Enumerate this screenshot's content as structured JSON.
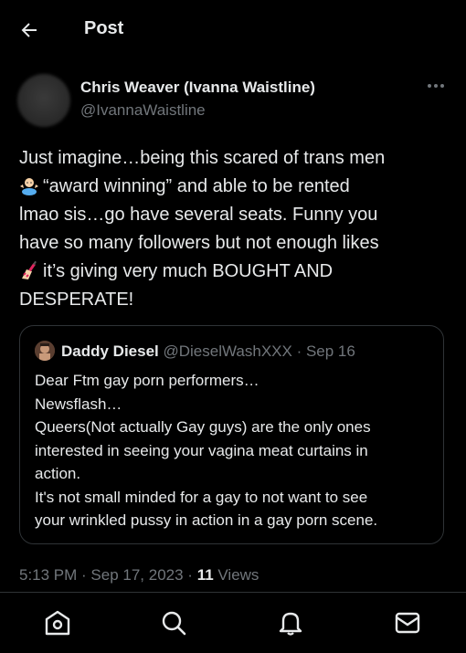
{
  "header": {
    "title": "Post"
  },
  "tweet": {
    "author_name": "Chris Weaver (Ivanna Waistline)",
    "author_handle": "@IvannaWaistline",
    "lines": [
      "Just imagine…being this scared of trans men",
      "“award winning” and able to be rented",
      "lmao sis…go have several seats. Funny you",
      "have so many followers but not enough likes",
      "it’s giving very much BOUGHT AND",
      "DESPERATE!"
    ],
    "emoji_1": "person-shrugging-emoji",
    "emoji_2": "nail-polish-emoji"
  },
  "quote": {
    "author_name": "Daddy Diesel",
    "author_handle": "@DieselWashXXX",
    "separator": " · ",
    "date": "Sep 16",
    "lines": [
      "Dear Ftm gay porn performers…",
      "Newsflash…",
      "Queers(Not actually Gay guys) are the only ones",
      "interested in seeing your vagina meat curtains in",
      "action.",
      "It's not small minded for a gay to not want to see",
      "your wrinkled pussy in action in a gay porn scene."
    ]
  },
  "meta": {
    "time": "5:13 PM",
    "sep1": " · ",
    "date": "Sep 17, 2023",
    "sep2": " · ",
    "views_count": "11",
    "views_label": " Views"
  },
  "nav": {
    "items": [
      "home-icon",
      "search-icon",
      "notifications-icon",
      "messages-icon"
    ]
  }
}
